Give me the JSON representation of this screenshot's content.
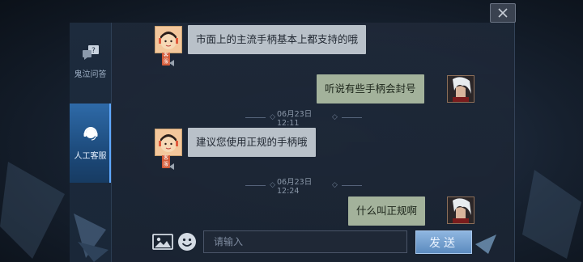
{
  "sidebar": {
    "items": [
      {
        "label": "鬼泣问答",
        "icon": "question-bubble-icon",
        "active": false
      },
      {
        "label": "人工客服",
        "icon": "headset-icon",
        "active": true
      }
    ]
  },
  "messages": [
    {
      "sender": "agent",
      "text": "市面上的主流手柄基本上都支持的哦",
      "tag": "客服"
    },
    {
      "sender": "user",
      "text": "听说有些手柄会封号"
    },
    {
      "sender": "agent",
      "text": "建议您使用正规的手柄哦",
      "tag": "客服"
    },
    {
      "sender": "user",
      "text": "什么叫正规啊"
    }
  ],
  "timestamps": [
    "06月23日 12:11",
    "06月23日 12:24"
  ],
  "composer": {
    "placeholder": "请输入",
    "send_label": "发送",
    "image_icon": "image-icon",
    "emoji_icon": "emoji-icon"
  },
  "close_icon": "close-icon",
  "colors": {
    "agent_bubble": "#b9c1c9",
    "user_bubble": "#a3b29b",
    "active_tab": "#2e6aa8",
    "send_button": "#6e9ace"
  }
}
